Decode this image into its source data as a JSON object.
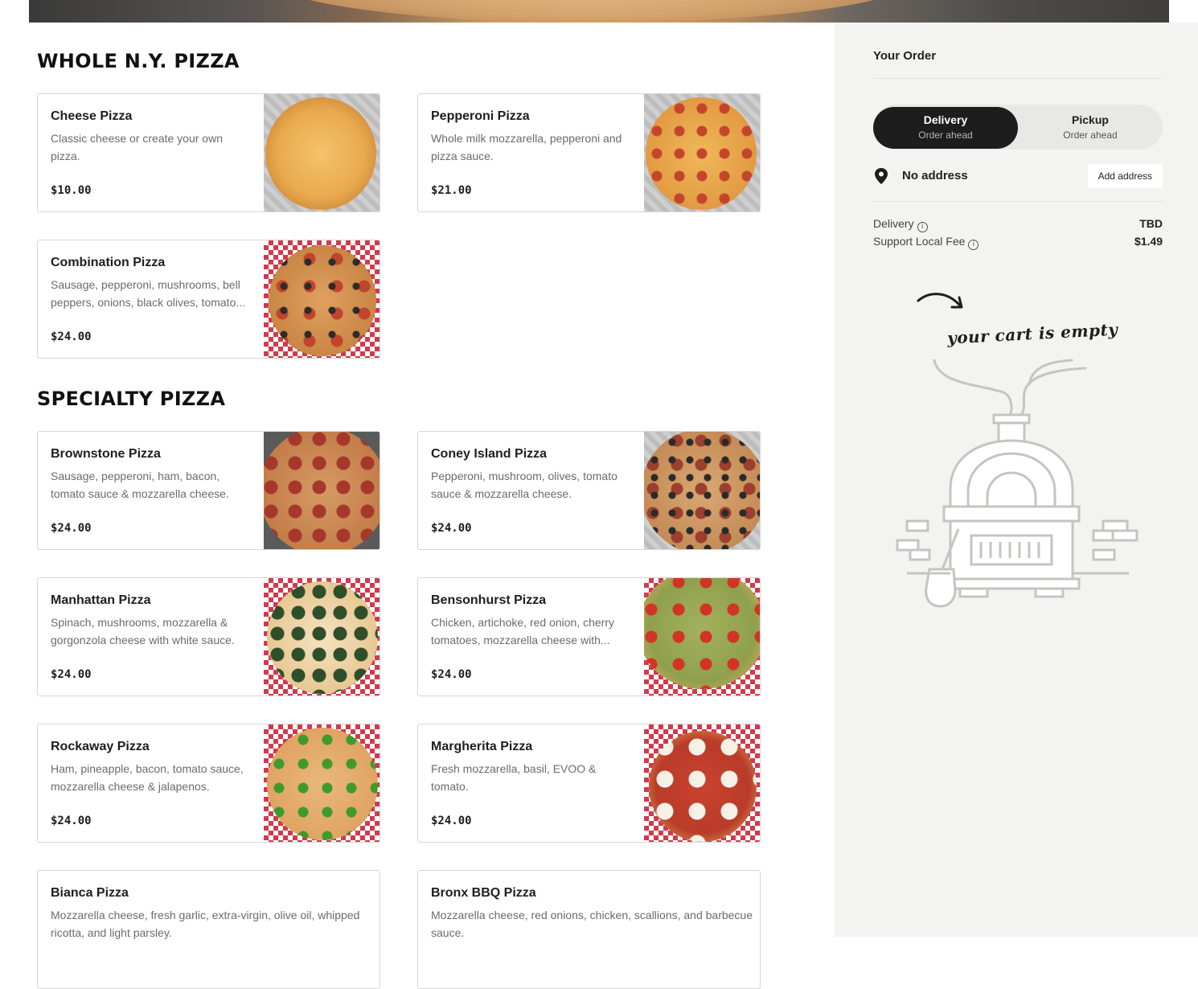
{
  "sections": [
    {
      "title": "WHOLE N.Y. PIZZA",
      "items": [
        {
          "name": "Cheese Pizza",
          "description": "Classic cheese or create your own pizza.",
          "price": "$10.00"
        },
        {
          "name": "Pepperoni Pizza",
          "description": "Whole milk mozzarella, pepperoni and pizza sauce.",
          "price": "$21.00"
        },
        {
          "name": "Combination Pizza",
          "description": "Sausage, pepperoni, mushrooms, bell peppers, onions, black olives, tomato...",
          "price": "$24.00"
        }
      ]
    },
    {
      "title": "SPECIALTY PIZZA",
      "items": [
        {
          "name": "Brownstone Pizza",
          "description": "Sausage, pepperoni, ham, bacon, tomato sauce & mozzarella cheese.",
          "price": "$24.00"
        },
        {
          "name": "Coney Island Pizza",
          "description": "Pepperoni, mushroom, olives, tomato sauce & mozzarella cheese.",
          "price": "$24.00"
        },
        {
          "name": "Manhattan Pizza",
          "description": "Spinach, mushrooms, mozzarella & gorgonzola cheese with white sauce.",
          "price": "$24.00"
        },
        {
          "name": "Bensonhurst Pizza",
          "description": "Chicken, artichoke, red onion, cherry tomatoes, mozzarella cheese with...",
          "price": "$24.00"
        },
        {
          "name": "Rockaway Pizza",
          "description": "Ham, pineapple, bacon, tomato sauce, mozzarella cheese & jalapenos.",
          "price": "$24.00"
        },
        {
          "name": "Margherita Pizza",
          "description": "Fresh mozzarella, basil, EVOO & tomato.",
          "price": "$24.00"
        },
        {
          "name": "Bianca Pizza",
          "description": "Mozzarella cheese, fresh garlic, extra-virgin, olive oil, whipped ricotta, and light parsley.",
          "price": ""
        },
        {
          "name": "Bronx BBQ Pizza",
          "description": "Mozzarella cheese, red onions, chicken, scallions, and barbecue sauce.",
          "price": ""
        }
      ]
    }
  ],
  "order": {
    "title": "Your Order",
    "delivery_option": {
      "label": "Delivery",
      "sub": "Order ahead"
    },
    "pickup_option": {
      "label": "Pickup",
      "sub": "Order ahead"
    },
    "address_text": "No address",
    "add_address_label": "Add address",
    "fees": [
      {
        "label": "Delivery",
        "value": "TBD"
      },
      {
        "label": "Support Local Fee",
        "value": "$1.49"
      }
    ],
    "empty_cart_text": "your cart is empty"
  },
  "colors": {
    "accent_dark": "#1d1d1d",
    "sidebar_bg": "#f3f3f1",
    "checker_red": "#d23a4c"
  },
  "icons": [
    "map-pin-icon",
    "info-icon",
    "arrow-icon",
    "pizza-oven-illustration"
  ]
}
